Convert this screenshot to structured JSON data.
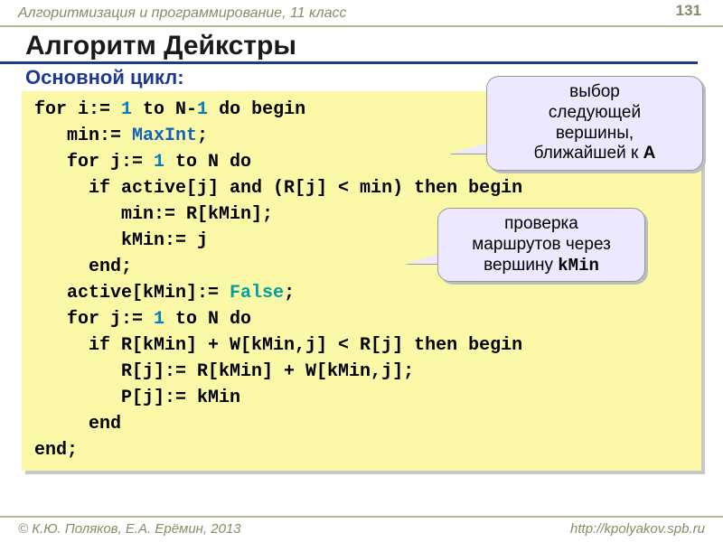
{
  "header": {
    "course": "Алгоритмизация и программирование, 11 класс",
    "page": "131"
  },
  "title": "Алгоритм Дейкстры",
  "subtitle": "Основной цикл:",
  "code": {
    "l1a": "for i:= ",
    "l1n": "1",
    "l1b": " to N-",
    "l1n2": "1",
    "l1c": " do begin",
    "l2a": "   min:= ",
    "l2m": "MaxInt",
    "l2b": ";",
    "l3a": "   for j:= ",
    "l3n": "1",
    "l3b": " to N do",
    "l4": "     if active[j] and (R[j] < min) then begin",
    "l5": "        min:= R[kMin];",
    "l6": "        kMin:= j",
    "l7": "     end;",
    "l8a": "   active[kMin]:= ",
    "l8f": "False",
    "l8b": ";",
    "l9a": "   for j:= ",
    "l9n": "1",
    "l9b": " to N do",
    "l10": "     if R[kMin] + W[kMin,j] < R[j] then begin",
    "l11": "        R[j]:= R[kMin] + W[kMin,j];",
    "l12": "        P[j]:= kMin",
    "l13": "     end",
    "l14": "end;"
  },
  "callout1": {
    "t1": "выбор",
    "t2": "следующей",
    "t3": "вершины,",
    "t4": "ближайшей к ",
    "t4b": "A"
  },
  "callout2": {
    "t1": "проверка",
    "t2": "маршрутов через",
    "t3": "вершину ",
    "t3b": "kMin"
  },
  "footer": {
    "credit": "© К.Ю. Поляков, Е.А. Ерёмин, 2013",
    "url": "http://kpolyakov.spb.ru"
  }
}
